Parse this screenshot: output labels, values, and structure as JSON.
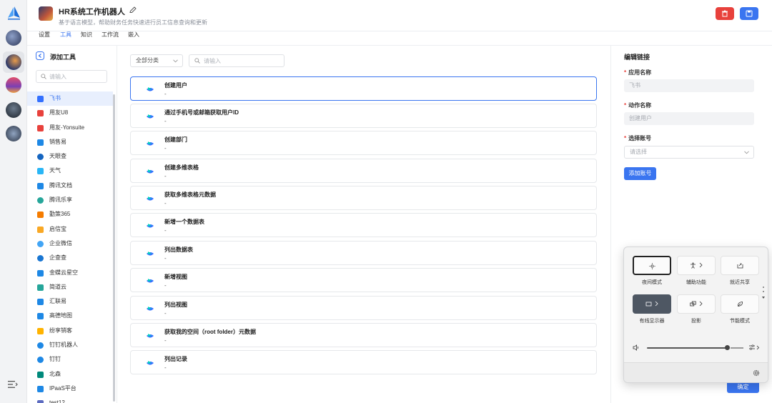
{
  "app": {
    "title": "HR系统工作机器人",
    "description": "基于语言模型，帮助财务任务快速进行员工信息查询和更新"
  },
  "tabs": [
    {
      "label": "设置"
    },
    {
      "label": "工具"
    },
    {
      "label": "知识"
    },
    {
      "label": "工作流"
    },
    {
      "label": "嵌入"
    }
  ],
  "sidebar": {
    "title": "添加工具",
    "search_placeholder": "请输入",
    "items": [
      {
        "label": "飞书",
        "color": "#3370ff"
      },
      {
        "label": "用友U8",
        "color": "#e8413c"
      },
      {
        "label": "用友-Yonsuite",
        "color": "#e8413c"
      },
      {
        "label": "销售易",
        "color": "#1e88e5"
      },
      {
        "label": "天眼查",
        "color": "#1565c0"
      },
      {
        "label": "天气",
        "color": "#29b6f6"
      },
      {
        "label": "腾讯文档",
        "color": "#1e88e5"
      },
      {
        "label": "腾讯乐享",
        "color": "#26a69a"
      },
      {
        "label": "勤策365",
        "color": "#f57c00"
      },
      {
        "label": "启信宝",
        "color": "#f9a825"
      },
      {
        "label": "企业微信",
        "color": "#42a5f5"
      },
      {
        "label": "企查查",
        "color": "#1976d2"
      },
      {
        "label": "金蝶云星空",
        "color": "#1e88e5"
      },
      {
        "label": "简道云",
        "color": "#26a69a"
      },
      {
        "label": "汇联易",
        "color": "#1e88e5"
      },
      {
        "label": "高德地图",
        "color": "#1e88e5"
      },
      {
        "label": "纷享销客",
        "color": "#ffb300"
      },
      {
        "label": "钉钉机器人",
        "color": "#1e88e5"
      },
      {
        "label": "钉钉",
        "color": "#1e88e5"
      },
      {
        "label": "北森",
        "color": "#00897b"
      },
      {
        "label": "IPaaS平台",
        "color": "#1e88e5"
      },
      {
        "label": "test12",
        "color": "#5c6bc0"
      }
    ]
  },
  "tool_list": {
    "category_select": "全部分类",
    "search_placeholder": "请输入",
    "tools": [
      {
        "name": "创建用户",
        "desc": "-"
      },
      {
        "name": "通过手机号或邮箱获取用户ID",
        "desc": "-"
      },
      {
        "name": "创建部门",
        "desc": "-"
      },
      {
        "name": "创建多维表格",
        "desc": "-"
      },
      {
        "name": "获取多维表格元数据",
        "desc": "-"
      },
      {
        "name": "新增一个数据表",
        "desc": "-"
      },
      {
        "name": "列出数据表",
        "desc": "-"
      },
      {
        "name": "新增视图",
        "desc": "-"
      },
      {
        "name": "列出视图",
        "desc": "-"
      },
      {
        "name": "获取我的空间（root folder）元数据",
        "desc": "-"
      },
      {
        "name": "列出记录",
        "desc": "-"
      }
    ]
  },
  "edit_panel": {
    "title": "编辑链接",
    "required_mark": "*",
    "app_name_label": "应用名称",
    "app_name_value": "飞书",
    "action_name_label": "动作名称",
    "action_name_value": "创建用户",
    "account_label": "选择账号",
    "account_placeholder": "请选择",
    "add_account_button": "添加账号",
    "confirm_button": "确定"
  },
  "quick_settings": {
    "tiles": [
      {
        "label": "夜间模式"
      },
      {
        "label": "辅助功能"
      },
      {
        "label": "就近共享"
      },
      {
        "label": "有线显示器"
      },
      {
        "label": "投影"
      },
      {
        "label": "节能模式"
      }
    ],
    "volume_level": 0.84
  }
}
